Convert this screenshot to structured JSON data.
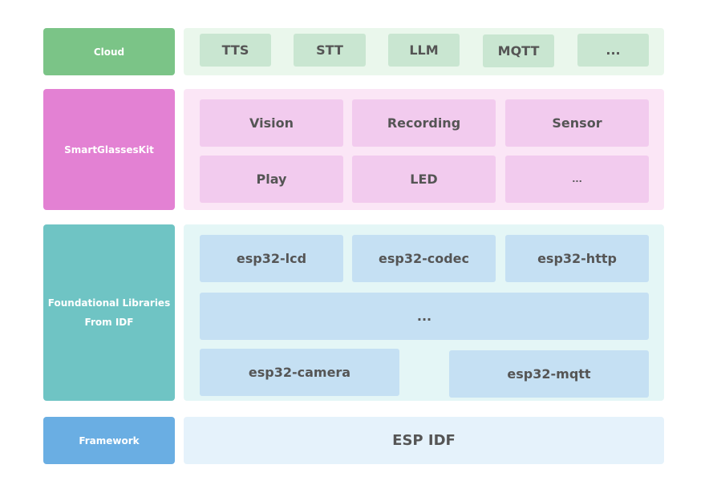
{
  "colors": {
    "cloud_label": "#7bc487",
    "cloud_panel": "#eaf7ec",
    "cloud_box": "#c9e6d1",
    "kit_label": "#e381d3",
    "kit_panel": "#fbe6f6",
    "kit_box": "#f2cbee",
    "lib_label": "#6fc4c4",
    "lib_panel": "#e4f6f6",
    "lib_box": "#c5e0f3",
    "fw_label": "#6aaee3",
    "fw_panel": "#e5f2fb",
    "text": "#555555"
  },
  "layers": {
    "cloud": {
      "label": "Cloud",
      "items": [
        "TTS",
        "STT",
        "LLM",
        "MQTT",
        "..."
      ]
    },
    "kit": {
      "label": "SmartGlassesKit",
      "items": [
        "Vision",
        "Recording",
        "Sensor",
        "Play",
        "LED",
        "..."
      ]
    },
    "libs": {
      "label_line1": "Foundational Libraries",
      "label_line2": "From IDF",
      "items": [
        "esp32-lcd",
        "esp32-codec",
        "esp32-http",
        "...",
        "esp32-camera",
        "esp32-mqtt"
      ]
    },
    "framework": {
      "label": "Framework",
      "item": "ESP IDF"
    }
  }
}
